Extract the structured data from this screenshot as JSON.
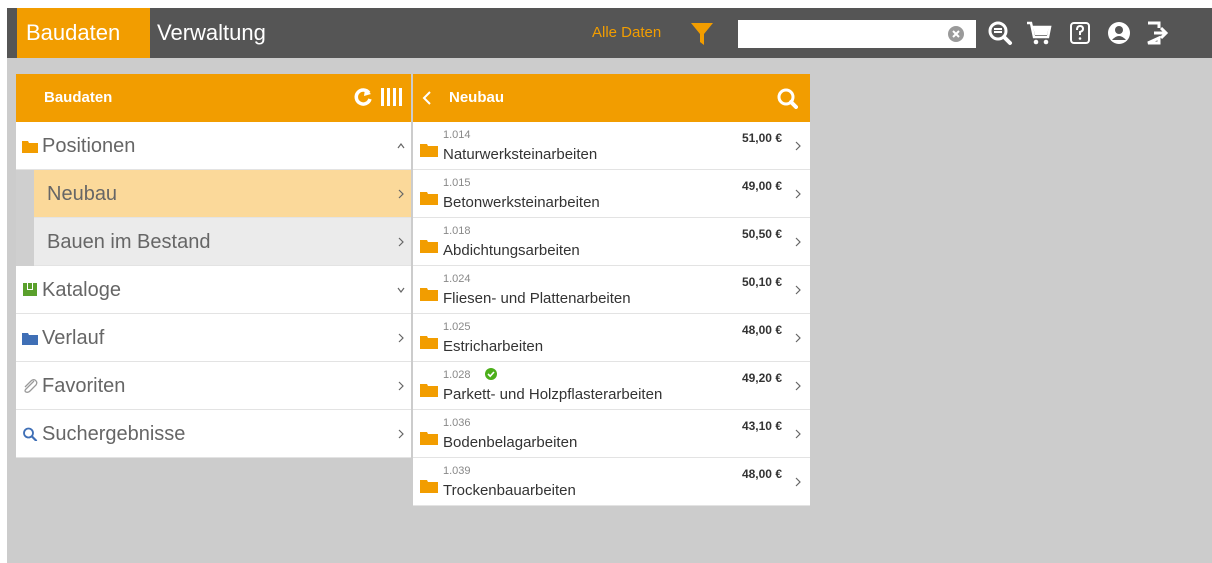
{
  "topbar": {
    "tabs": [
      {
        "label": "Baudaten",
        "active": true
      },
      {
        "label": "Verwaltung",
        "active": false
      }
    ],
    "filter_label": "Alle Daten",
    "search": {
      "value": "",
      "placeholder": ""
    },
    "icons": [
      "filter-icon",
      "clear-icon",
      "zoom-search-icon",
      "cart-icon",
      "help-icon",
      "user-icon",
      "logout-icon"
    ]
  },
  "left_panel": {
    "title": "Baudaten",
    "items": [
      {
        "label": "Positionen",
        "icon": "folder-icon",
        "state": "expanded"
      },
      {
        "label": "Kataloge",
        "icon": "catalog-icon",
        "state": "collapsed"
      },
      {
        "label": "Verlauf",
        "icon": "folder-icon",
        "state": "arrow"
      },
      {
        "label": "Favoriten",
        "icon": "paperclip-icon",
        "state": "arrow"
      },
      {
        "label": "Suchergebnisse",
        "icon": "search-icon",
        "state": "arrow"
      }
    ],
    "sub_items": [
      {
        "label": "Neubau",
        "active": true
      },
      {
        "label": "Bauen im Bestand",
        "active": false
      }
    ]
  },
  "right_panel": {
    "title": "Neubau",
    "items": [
      {
        "code": "1.014",
        "name": "Naturwerksteinarbeiten",
        "price": "51,00 €"
      },
      {
        "code": "1.015",
        "name": "Betonwerksteinarbeiten",
        "price": "49,00 €"
      },
      {
        "code": "1.018",
        "name": "Abdichtungsarbeiten",
        "price": "50,50 €"
      },
      {
        "code": "1.024",
        "name": "Fliesen- und Plattenarbeiten",
        "price": "50,10 €"
      },
      {
        "code": "1.025",
        "name": "Estricharbeiten",
        "price": "48,00 €"
      },
      {
        "code": "1.028",
        "name": "Parkett- und Holzpflasterarbeiten",
        "price": "49,20 €",
        "checked": true
      },
      {
        "code": "1.036",
        "name": "Bodenbelagarbeiten",
        "price": "43,10 €"
      },
      {
        "code": "1.039",
        "name": "Trockenbauarbeiten",
        "price": "48,00 €"
      }
    ]
  },
  "colors": {
    "accent": "#f29d00",
    "topbar": "#555555",
    "background": "#cccccc",
    "active_row": "#fbd99a",
    "check": "#4caf1a"
  }
}
